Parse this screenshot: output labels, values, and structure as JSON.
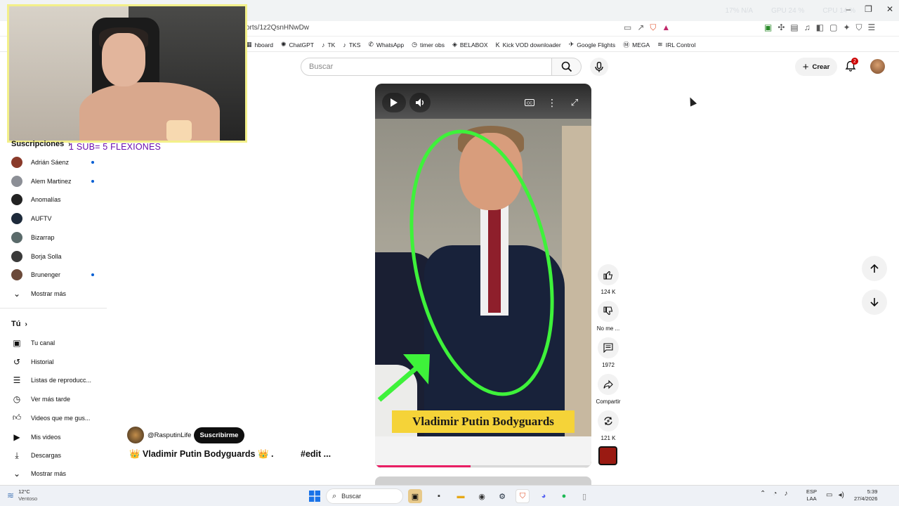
{
  "browser": {
    "stats": [
      "17% N/A",
      "GPU 24 %",
      "CPU 14 %"
    ],
    "url": "orts/1z2QsnHNwDw",
    "bookmarks": [
      {
        "icon": "dashboard-icon",
        "label": "hboard"
      },
      {
        "icon": "chatgpt-icon",
        "label": "ChatGPT"
      },
      {
        "icon": "tiktok-icon",
        "label": "TK"
      },
      {
        "icon": "tiktok-icon",
        "label": "TKS"
      },
      {
        "icon": "whatsapp-icon",
        "label": "WhatsApp"
      },
      {
        "icon": "timer-icon",
        "label": "timer obs"
      },
      {
        "icon": "belabox-icon",
        "label": "BELABOX"
      },
      {
        "icon": "kick-icon",
        "label": "Kick VOD downloader"
      },
      {
        "icon": "google-flights-icon",
        "label": "Google Flights"
      },
      {
        "icon": "mega-icon",
        "label": "MEGA"
      },
      {
        "icon": "irl-icon",
        "label": "IRL Control"
      }
    ]
  },
  "overlay": {
    "sub_text": "1 SUB= 5 FLEXIONES"
  },
  "sidebar": {
    "subscriptions_label": "Suscripciones",
    "channels": [
      {
        "name": "Adrián Sáenz",
        "new": true,
        "color": "#8a3a2a"
      },
      {
        "name": "Alem Martinez",
        "new": true,
        "color": "#8c8f96"
      },
      {
        "name": "Anomalías",
        "new": false,
        "color": "#222222"
      },
      {
        "name": "AUFTV",
        "new": false,
        "color": "#1d2a3a"
      },
      {
        "name": "Bizarrap",
        "new": false,
        "color": "#5a6a6a"
      },
      {
        "name": "Borja Solla",
        "new": false,
        "color": "#3a3a3a"
      },
      {
        "name": "Brunenger",
        "new": true,
        "color": "#6b4a3a"
      }
    ],
    "show_more": "Mostrar más",
    "you_label": "Tú",
    "you_items": [
      {
        "icon": "channel-icon",
        "label": "Tu canal"
      },
      {
        "icon": "history-icon",
        "label": "Historial"
      },
      {
        "icon": "playlist-icon",
        "label": "Listas de reproducc..."
      },
      {
        "icon": "clock-icon",
        "label": "Ver más tarde"
      },
      {
        "icon": "thumb-up-icon",
        "label": "Videos que me gus..."
      },
      {
        "icon": "my-videos-icon",
        "label": "Mis videos"
      },
      {
        "icon": "download-icon",
        "label": "Descargas"
      }
    ],
    "show_more_2": "Mostrar más"
  },
  "topbar": {
    "search_placeholder": "Buscar",
    "create_label": "Crear",
    "notification_count": "2"
  },
  "video": {
    "caption": "Vladimir Putin Bodyguards",
    "progress": 0.44
  },
  "actions": {
    "likes": "124 K",
    "dislike_label": "No me ...",
    "comments": "1972",
    "share_label": "Compartir",
    "remix": "121 K"
  },
  "channel": {
    "handle": "@RasputinLife",
    "subscribe_label": "Suscribirme",
    "title": "👑 Vladimir Putin Bodyguards 👑 .",
    "tag": "#edit ..."
  },
  "taskbar": {
    "temperature": "12°C",
    "weather": "Ventoso",
    "search_label": "Buscar",
    "lang_1": "ESP",
    "lang_2": "LAA",
    "time": "5:39",
    "date": "27/4/2026"
  }
}
